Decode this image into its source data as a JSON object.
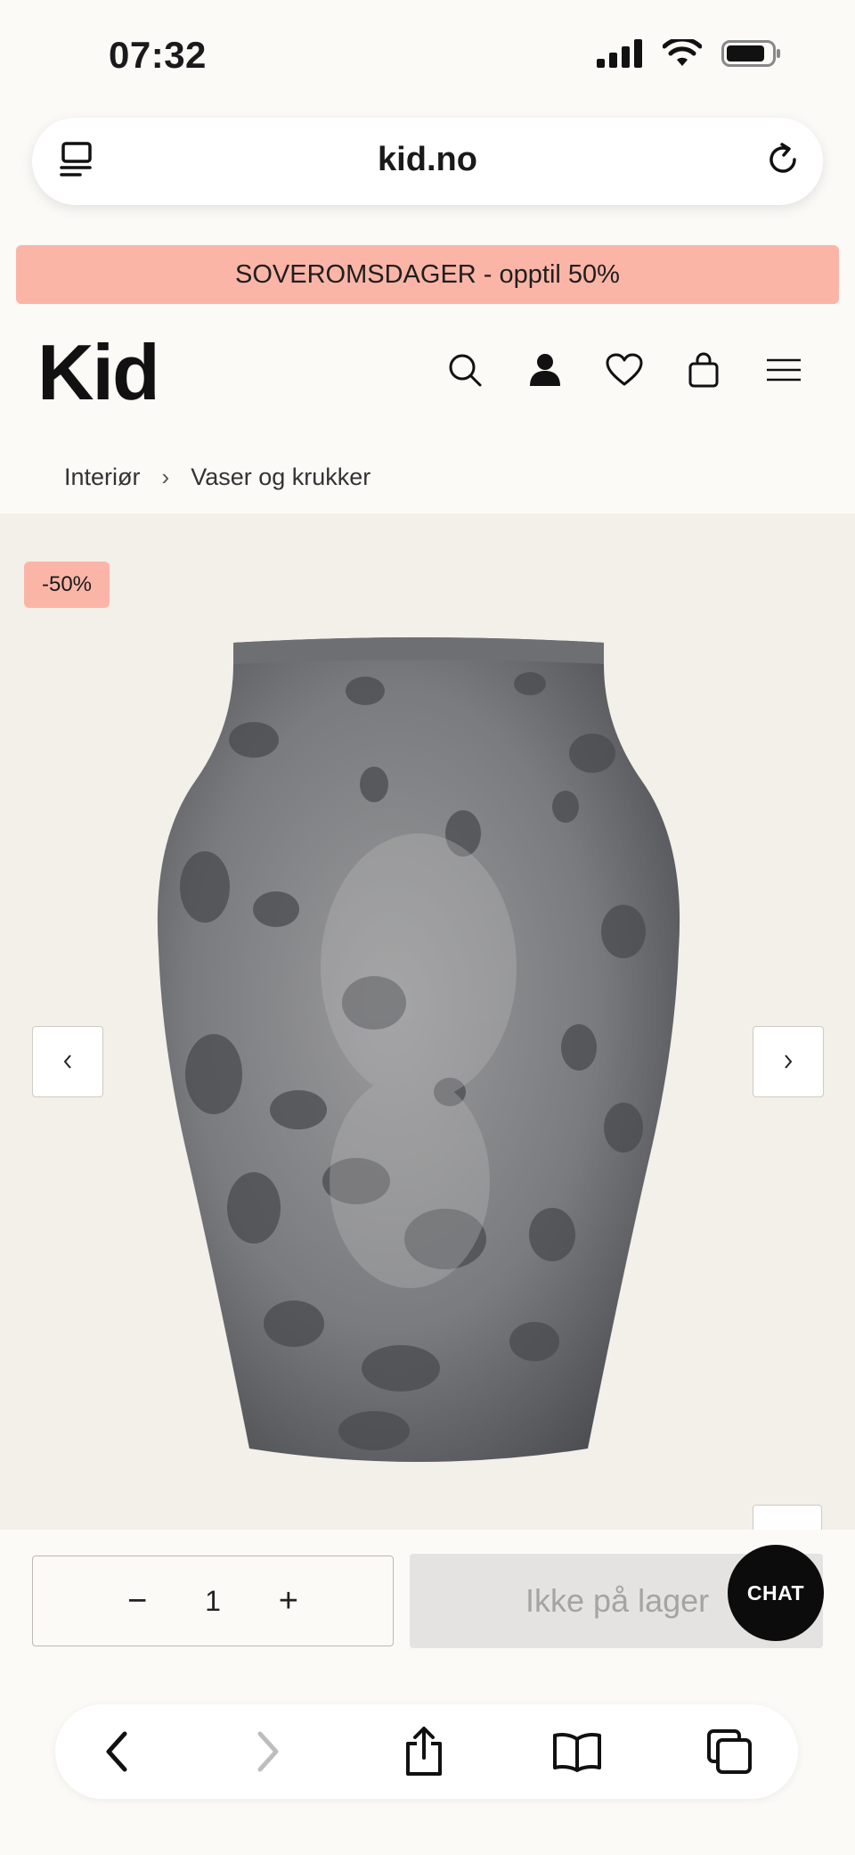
{
  "status": {
    "time": "07:32",
    "icons": [
      "cellular-signal-icon",
      "wifi-icon",
      "battery-icon"
    ]
  },
  "browser": {
    "url": "kid.no",
    "left_icon": "reader-mode-icon",
    "reload_icon": "reload-icon"
  },
  "promo": {
    "text": "SOVEROMSDAGER - opptil 50%",
    "color": "#fbb5a7"
  },
  "header": {
    "logo": "Kid",
    "icons": [
      "search-icon",
      "account-icon",
      "wishlist-heart-icon",
      "cart-bag-icon",
      "menu-icon"
    ]
  },
  "breadcrumb": {
    "items": [
      {
        "label": "Interiør"
      },
      {
        "label": "Vaser og krukker"
      }
    ],
    "separator": "›"
  },
  "product": {
    "discount_badge": "-50%",
    "image_alt_icon": "vase-image",
    "prev_icon": "chevron-left-icon",
    "next_icon": "chevron-right-icon"
  },
  "purchase": {
    "minus": "−",
    "quantity": "1",
    "plus": "+",
    "stock_label": "Ikke på lager",
    "chat_label": "CHAT"
  },
  "toolbar": {
    "icons": [
      "back-icon",
      "forward-icon",
      "share-icon",
      "bookmarks-icon",
      "tabs-icon"
    ]
  },
  "colors": {
    "background": "#fbfaf7",
    "accent_pink": "#fbb5a7",
    "media_bg": "#f3efe9",
    "disabled_button": "#e4e3e1"
  }
}
